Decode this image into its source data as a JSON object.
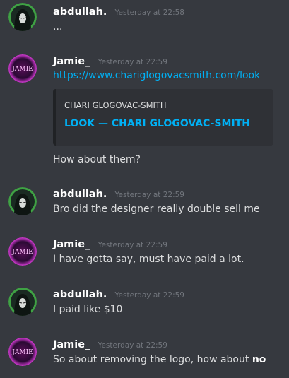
{
  "users": {
    "abdullah": {
      "name": "abdullah.",
      "avatar_icon": "hooded-figure-avatar-icon",
      "ring_color": "#3fa244"
    },
    "jamie": {
      "name": "Jamie_",
      "avatar_icon": "neon-jamie-avatar-icon",
      "avatar_text": "JAMIE",
      "glow_color": "#d63bd6"
    }
  },
  "messages": [
    {
      "author": "abdullah.",
      "timestamp": "Yesterday at 22:58",
      "text": "..."
    },
    {
      "author": "Jamie_",
      "timestamp": "Yesterday at 22:59",
      "link": "https://www.chariglogovacsmith.com/look",
      "embed": {
        "provider": "CHARI GLOGOVAC-SMITH",
        "title": "LOOK — CHARI GLOGOVAC-SMITH"
      },
      "text": "How about them?"
    },
    {
      "author": "abdullah.",
      "timestamp": "Yesterday at 22:59",
      "text": "Bro did the designer really double sell me"
    },
    {
      "author": "Jamie_",
      "timestamp": "Yesterday at 22:59",
      "text": "I have gotta say, must have paid a lot."
    },
    {
      "author": "abdullah.",
      "timestamp": "Yesterday at 22:59",
      "text": "I paid like $10"
    },
    {
      "author": "Jamie_",
      "timestamp": "Yesterday at 22:59",
      "text": "So about removing the logo, how about ",
      "bold": "no"
    }
  ],
  "colors": {
    "background": "#36393f",
    "link": "#00b0f4",
    "embed_background": "#2f3136",
    "timestamp": "#72767d",
    "text": "#dcddde"
  }
}
